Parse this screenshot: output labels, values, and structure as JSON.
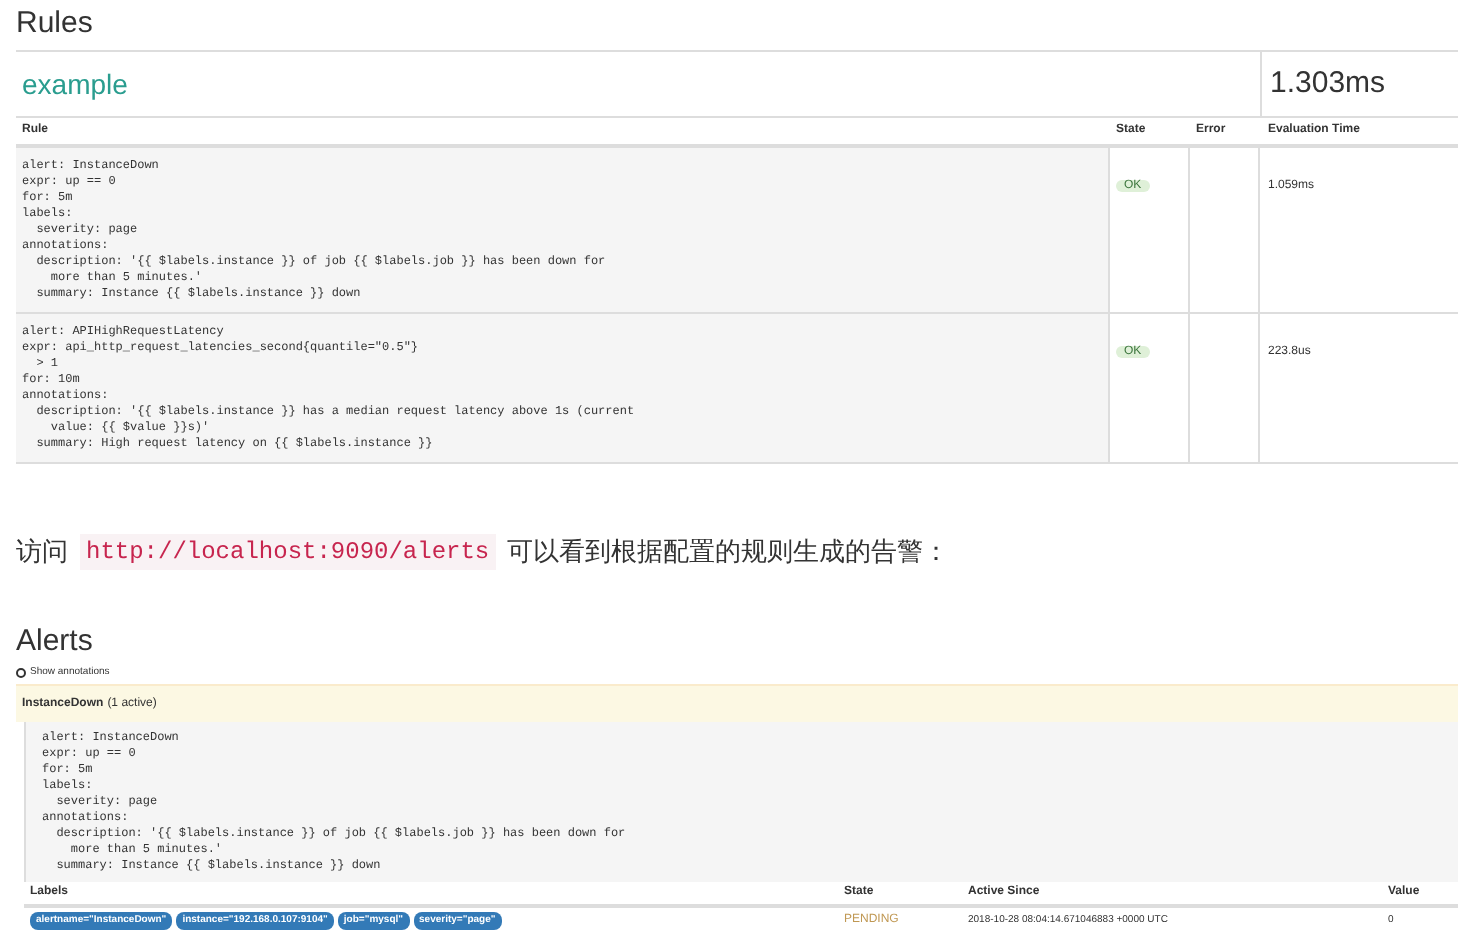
{
  "rules_section": {
    "title": "Rules",
    "group": {
      "name": "example",
      "evaluation_time": "1.303ms"
    },
    "columns": [
      "Rule",
      "State",
      "Error",
      "Evaluation Time"
    ],
    "rules": [
      {
        "lines": [
          "alert: InstanceDown",
          "expr: up == 0",
          "for: 5m",
          "labels:",
          "  severity: page",
          "annotations:",
          "  description: '{{ $labels.instance }} of job {{ $labels.job }} has been down for",
          "    more than 5 minutes.'",
          "  summary: Instance {{ $labels.instance }} down"
        ],
        "state": {
          "text": "OK",
          "kind": "success"
        },
        "evaluation_time": "1.059ms"
      },
      {
        "lines": [
          "alert: APIHighRequestLatency",
          "expr: api_http_request_latencies_second{quantile=\"0.5\"}",
          "  > 1",
          "for: 10m",
          "annotations:",
          "  description: '{{ $labels.instance }} has a median request latency above 1s (current",
          "    value: {{ $value }}s)'",
          "  summary: High request latency on {{ $labels.instance }}"
        ],
        "state": {
          "text": "OK",
          "kind": "success"
        },
        "evaluation_time": "223.8us"
      }
    ]
  },
  "paragraph": {
    "before": "访问",
    "link": "http://localhost:9090/alerts",
    "after": "可以看到根据配置的规则生成的告警："
  },
  "alerts_section": {
    "title": "Alerts",
    "annotations_toggle": {
      "label": "Show annotations",
      "checked": false
    },
    "alert_group": {
      "name": "InstanceDown",
      "count": "(1 active)",
      "lines": [
        "alert: InstanceDown",
        "expr: up == 0",
        "for: 5m",
        "labels:",
        "  severity: page",
        "annotations:",
        "  description: '{{ $labels.instance }} of job {{ $labels.job }} has been down for",
        "    more than 5 minutes.'",
        "  summary: Instance {{ $labels.instance }} down"
      ],
      "columns": [
        "Labels",
        "State",
        "Active Since",
        "Value"
      ],
      "rows": [
        {
          "labels": [
            "alertname=\"InstanceDown\"",
            "instance=\"192.168.0.107:9104\"",
            "job=\"mysql\"",
            "severity=\"page\""
          ],
          "state": {
            "text": "PENDING",
            "kind": "warning"
          },
          "active_since": "2018-10-28 08:04:14.671046883 +0000 UTC",
          "value": "0"
        }
      ]
    }
  }
}
